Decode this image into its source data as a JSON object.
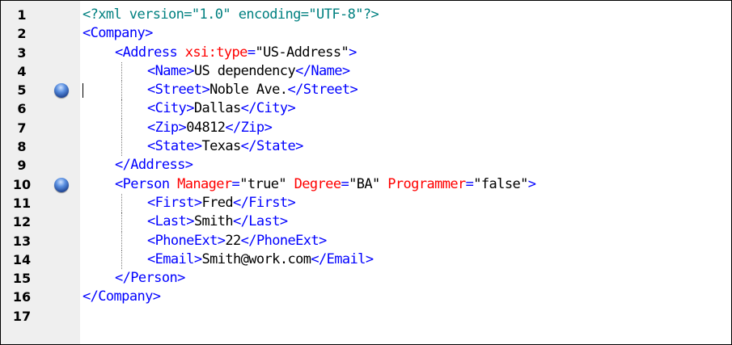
{
  "editor": {
    "bookmark_lines": [
      5,
      10
    ],
    "caret_line": 5,
    "lines": [
      {
        "num": "1",
        "indent": 0,
        "tokens": [
          [
            "pi",
            "<?xml version=\"1.0\" encoding=\"UTF-8\"?>"
          ]
        ]
      },
      {
        "num": "2",
        "indent": 0,
        "tokens": [
          [
            "br",
            "<"
          ],
          [
            "tag",
            "Company"
          ],
          [
            "br",
            ">"
          ]
        ]
      },
      {
        "num": "3",
        "indent": 1,
        "tokens": [
          [
            "br",
            "<"
          ],
          [
            "tag",
            "Address"
          ],
          [
            "txt",
            " "
          ],
          [
            "attr",
            "xsi:type"
          ],
          [
            "eq",
            "="
          ],
          [
            "val",
            "\"US-Address\""
          ],
          [
            "br",
            ">"
          ]
        ]
      },
      {
        "num": "4",
        "indent": 2,
        "tokens": [
          [
            "br",
            "<"
          ],
          [
            "tag",
            "Name"
          ],
          [
            "br",
            ">"
          ],
          [
            "txt",
            "US dependency"
          ],
          [
            "br",
            "</"
          ],
          [
            "tag",
            "Name"
          ],
          [
            "br",
            ">"
          ]
        ]
      },
      {
        "num": "5",
        "indent": 2,
        "tokens": [
          [
            "br",
            "<"
          ],
          [
            "tag",
            "Street"
          ],
          [
            "br",
            ">"
          ],
          [
            "txt",
            "Noble Ave."
          ],
          [
            "br",
            "</"
          ],
          [
            "tag",
            "Street"
          ],
          [
            "br",
            ">"
          ]
        ]
      },
      {
        "num": "6",
        "indent": 2,
        "tokens": [
          [
            "br",
            "<"
          ],
          [
            "tag",
            "City"
          ],
          [
            "br",
            ">"
          ],
          [
            "txt",
            "Dallas"
          ],
          [
            "br",
            "</"
          ],
          [
            "tag",
            "City"
          ],
          [
            "br",
            ">"
          ]
        ]
      },
      {
        "num": "7",
        "indent": 2,
        "tokens": [
          [
            "br",
            "<"
          ],
          [
            "tag",
            "Zip"
          ],
          [
            "br",
            ">"
          ],
          [
            "txt",
            "04812"
          ],
          [
            "br",
            "</"
          ],
          [
            "tag",
            "Zip"
          ],
          [
            "br",
            ">"
          ]
        ]
      },
      {
        "num": "8",
        "indent": 2,
        "tokens": [
          [
            "br",
            "<"
          ],
          [
            "tag",
            "State"
          ],
          [
            "br",
            ">"
          ],
          [
            "txt",
            "Texas"
          ],
          [
            "br",
            "</"
          ],
          [
            "tag",
            "State"
          ],
          [
            "br",
            ">"
          ]
        ]
      },
      {
        "num": "9",
        "indent": 1,
        "tokens": [
          [
            "br",
            "</"
          ],
          [
            "tag",
            "Address"
          ],
          [
            "br",
            ">"
          ]
        ]
      },
      {
        "num": "10",
        "indent": 1,
        "tokens": [
          [
            "br",
            "<"
          ],
          [
            "tag",
            "Person"
          ],
          [
            "txt",
            " "
          ],
          [
            "attr",
            "Manager"
          ],
          [
            "eq",
            "="
          ],
          [
            "val",
            "\"true\""
          ],
          [
            "txt",
            " "
          ],
          [
            "attr",
            "Degree"
          ],
          [
            "eq",
            "="
          ],
          [
            "val",
            "\"BA\""
          ],
          [
            "txt",
            " "
          ],
          [
            "attr",
            "Programmer"
          ],
          [
            "eq",
            "="
          ],
          [
            "val",
            "\"false\""
          ],
          [
            "br",
            ">"
          ]
        ]
      },
      {
        "num": "11",
        "indent": 2,
        "tokens": [
          [
            "br",
            "<"
          ],
          [
            "tag",
            "First"
          ],
          [
            "br",
            ">"
          ],
          [
            "txt",
            "Fred"
          ],
          [
            "br",
            "</"
          ],
          [
            "tag",
            "First"
          ],
          [
            "br",
            ">"
          ]
        ]
      },
      {
        "num": "12",
        "indent": 2,
        "tokens": [
          [
            "br",
            "<"
          ],
          [
            "tag",
            "Last"
          ],
          [
            "br",
            ">"
          ],
          [
            "txt",
            "Smith"
          ],
          [
            "br",
            "</"
          ],
          [
            "tag",
            "Last"
          ],
          [
            "br",
            ">"
          ]
        ]
      },
      {
        "num": "13",
        "indent": 2,
        "tokens": [
          [
            "br",
            "<"
          ],
          [
            "tag",
            "PhoneExt"
          ],
          [
            "br",
            ">"
          ],
          [
            "txt",
            "22"
          ],
          [
            "br",
            "</"
          ],
          [
            "tag",
            "PhoneExt"
          ],
          [
            "br",
            ">"
          ]
        ]
      },
      {
        "num": "14",
        "indent": 2,
        "tokens": [
          [
            "br",
            "<"
          ],
          [
            "tag",
            "Email"
          ],
          [
            "br",
            ">"
          ],
          [
            "txt",
            "Smith@work.com"
          ],
          [
            "br",
            "</"
          ],
          [
            "tag",
            "Email"
          ],
          [
            "br",
            ">"
          ]
        ]
      },
      {
        "num": "15",
        "indent": 1,
        "tokens": [
          [
            "br",
            "</"
          ],
          [
            "tag",
            "Person"
          ],
          [
            "br",
            ">"
          ]
        ]
      },
      {
        "num": "16",
        "indent": 0,
        "tokens": [
          [
            "br",
            "</"
          ],
          [
            "tag",
            "Company"
          ],
          [
            "br",
            ">"
          ]
        ]
      },
      {
        "num": "17",
        "indent": 0,
        "tokens": []
      }
    ]
  }
}
